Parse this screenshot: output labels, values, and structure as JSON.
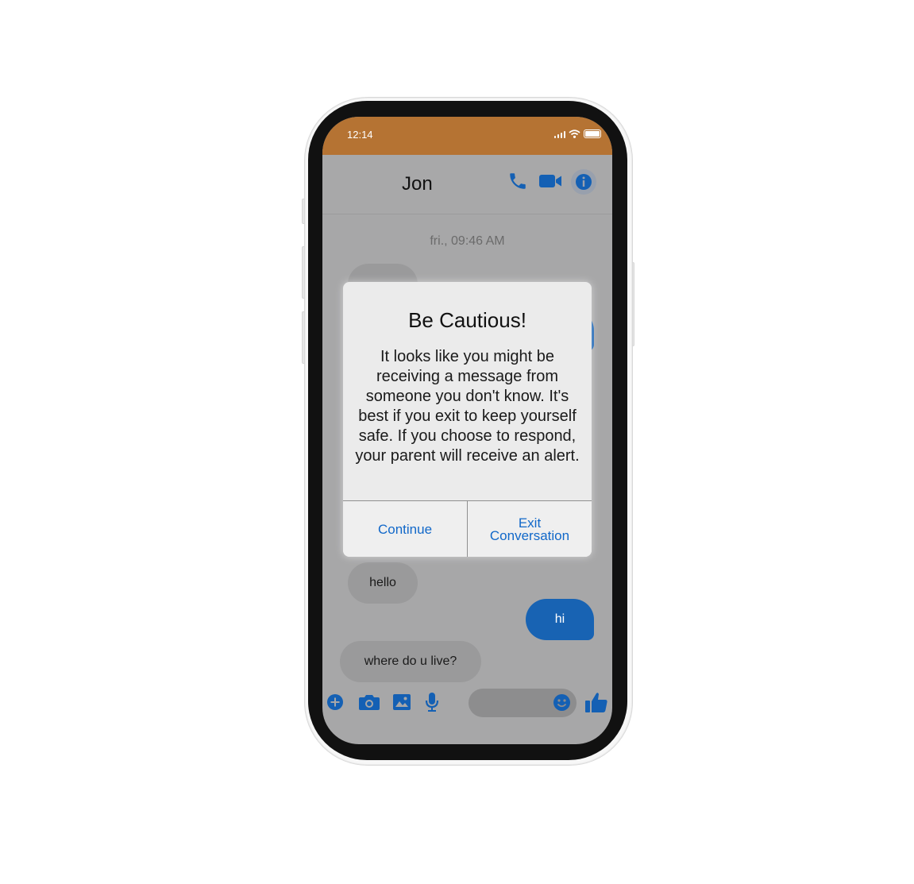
{
  "status_bar": {
    "time": "12:14"
  },
  "chat": {
    "contact_name": "Jon",
    "timestamp": "fri., 09:46 AM",
    "messages": [
      {
        "text": "hello",
        "from": "them"
      },
      {
        "text": "hi",
        "from": "me"
      },
      {
        "text": "where do u live?",
        "from": "them"
      }
    ]
  },
  "dialog": {
    "title": "Be Cautious!",
    "body": "It looks like you might be receiving a message from someone you don't know. It's best if you exit to keep yourself safe. If you choose to respond, your parent will receive an alert.",
    "continue_label": "Continue",
    "exit_label": "Exit Conversation"
  },
  "colors": {
    "status_bar": "#b57333",
    "accent": "#1863b3",
    "dialog_button_text": "#1168c9"
  },
  "icons": [
    "signal-icon",
    "wifi-icon",
    "battery-icon",
    "phone-icon",
    "video-icon",
    "info-icon",
    "plus-icon",
    "camera-icon",
    "image-icon",
    "microphone-icon",
    "emoji-icon",
    "thumbs-up-icon"
  ]
}
